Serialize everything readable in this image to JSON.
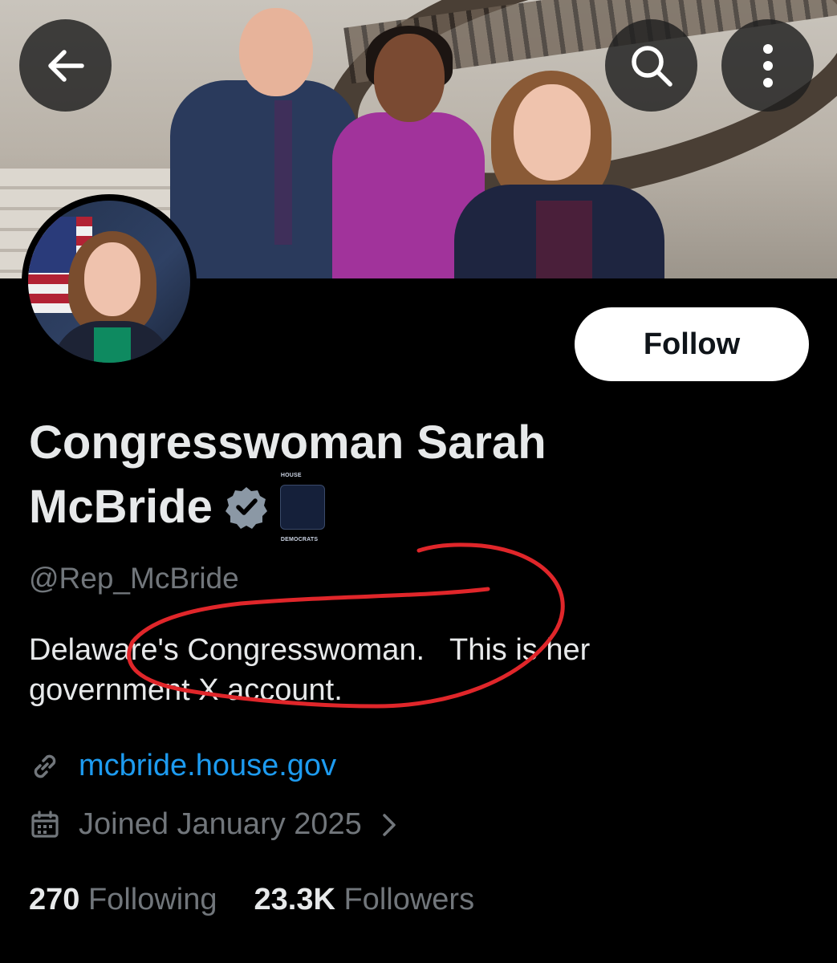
{
  "header": {
    "back_icon": "arrow-left-icon",
    "search_icon": "search-icon",
    "more_icon": "more-vertical-icon"
  },
  "profile": {
    "name_line1": "Congresswoman Sarah",
    "name_line2": "McBride",
    "verified_icon": "verified-badge-icon",
    "affiliation_badge_text": "HOUSE DEMOCRATS",
    "handle": "@Rep_McBride",
    "bio": "Delaware's Congresswoman.   This is her government X account.",
    "website": "mcbride.house.gov",
    "joined": "Joined January 2025",
    "following_count": "270",
    "following_label": "Following",
    "followers_count": "23.3K",
    "followers_label": "Followers"
  },
  "actions": {
    "follow_label": "Follow"
  },
  "colors": {
    "link": "#1d9bf0",
    "secondary_text": "#71767b",
    "annotation": "#e0262a"
  }
}
